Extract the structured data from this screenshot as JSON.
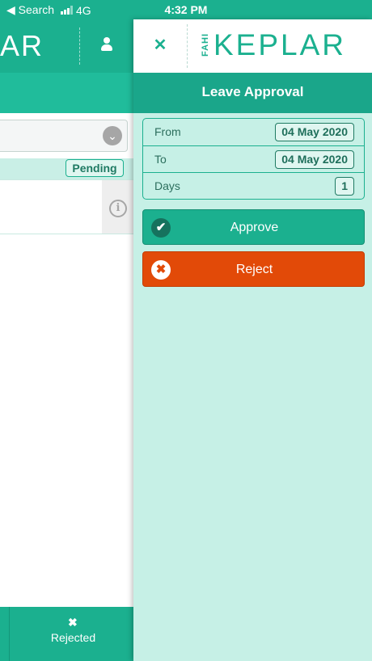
{
  "status_bar": {
    "back_app": "◀ Search",
    "network": "4G",
    "time": "4:32 PM"
  },
  "background_page": {
    "logo_fragment": "AR",
    "status_badge": "Pending",
    "footer_tab_label": "Rejected"
  },
  "panel": {
    "title": "Leave Approval",
    "logo": {
      "sub": "FAHI",
      "main": "KEPLAR"
    },
    "details": [
      {
        "label": "From",
        "value": "04 May 2020"
      },
      {
        "label": "To",
        "value": "04 May 2020"
      },
      {
        "label": "Days",
        "value": "1"
      }
    ],
    "actions": {
      "approve_label": "Approve",
      "reject_label": "Reject"
    }
  },
  "icons": [
    "signal-icon",
    "user-icon",
    "chevron-down-icon",
    "info-icon",
    "close-icon",
    "check-icon",
    "x-circle-icon"
  ],
  "colors": {
    "brand": "#1bb08f",
    "panel_bg": "#c6f0e6",
    "reject": "#e24a08"
  }
}
